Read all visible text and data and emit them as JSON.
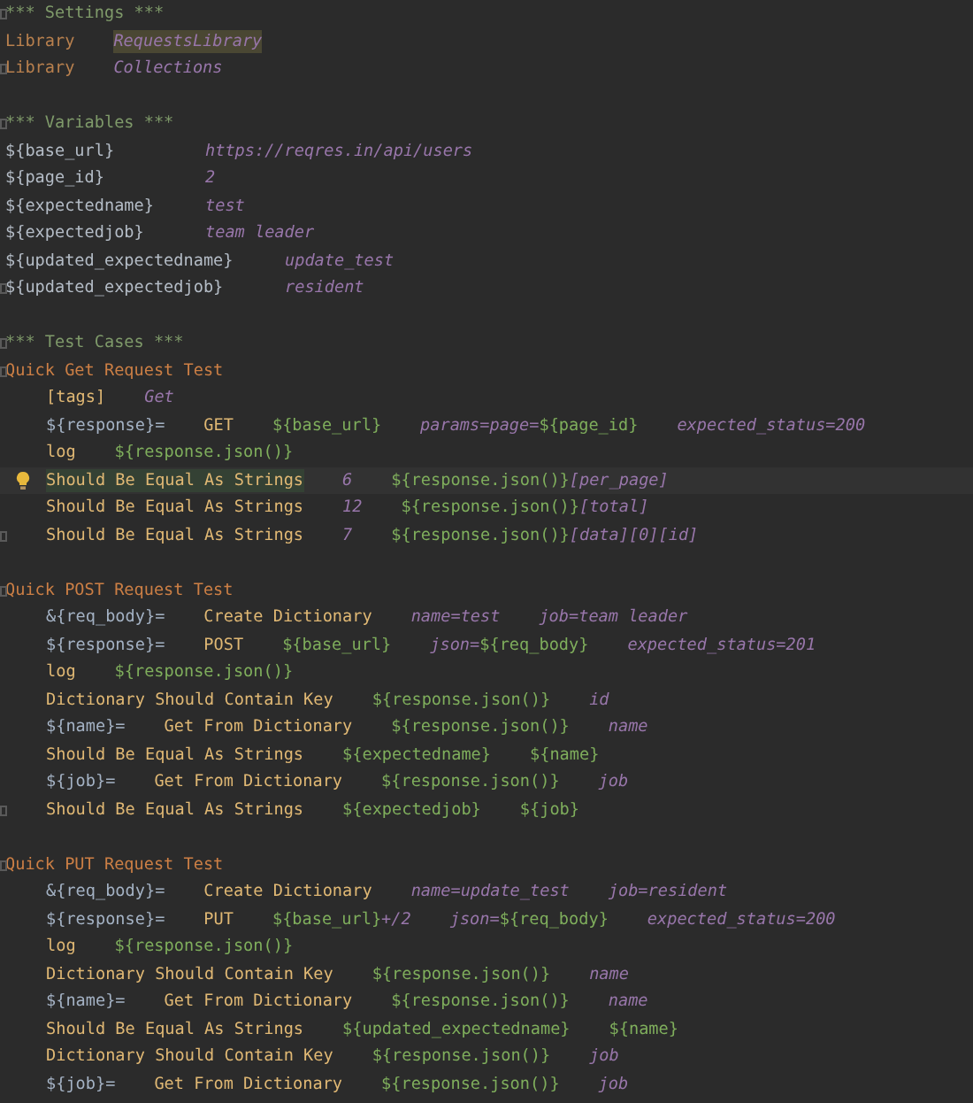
{
  "editor": {
    "lines": [
      {
        "kind": "code",
        "fold_marker": true,
        "tokens": [
          {
            "text": "*** Settings ***",
            "kind": "header"
          }
        ]
      },
      {
        "kind": "code",
        "tokens": [
          {
            "text": "Library",
            "kind": "setting"
          },
          {
            "text": "RequestsLibrary",
            "kind": "value",
            "highlighted": true
          }
        ]
      },
      {
        "kind": "code",
        "fold_marker": true,
        "tokens": [
          {
            "text": "Library",
            "kind": "setting"
          },
          {
            "text": "Collections",
            "kind": "value"
          }
        ]
      },
      {
        "kind": "blank"
      },
      {
        "kind": "code",
        "fold_marker": true,
        "tokens": [
          {
            "text": "*** Variables ***",
            "kind": "header"
          }
        ]
      },
      {
        "kind": "code",
        "tokens": [
          {
            "text": "${base_url}",
            "kind": "variable"
          },
          {
            "text": "https://reqres.in/api/users",
            "kind": "value"
          }
        ]
      },
      {
        "kind": "code",
        "tokens": [
          {
            "text": "${page_id}",
            "kind": "variable"
          },
          {
            "text": "2",
            "kind": "value"
          }
        ]
      },
      {
        "kind": "code",
        "tokens": [
          {
            "text": "${expectedname}",
            "kind": "variable"
          },
          {
            "text": "test",
            "kind": "value"
          }
        ]
      },
      {
        "kind": "code",
        "tokens": [
          {
            "text": "${expectedjob}",
            "kind": "variable"
          },
          {
            "text": "team leader",
            "kind": "value"
          }
        ]
      },
      {
        "kind": "code",
        "tokens": [
          {
            "text": "${updated_expectedname}",
            "kind": "variable"
          },
          {
            "text": "update_test",
            "kind": "value"
          }
        ]
      },
      {
        "kind": "code",
        "fold_marker": true,
        "tokens": [
          {
            "text": "${updated_expectedjob}",
            "kind": "variable"
          },
          {
            "text": "resident",
            "kind": "value"
          }
        ]
      },
      {
        "kind": "blank"
      },
      {
        "kind": "code",
        "fold_marker": true,
        "tokens": [
          {
            "text": "*** Test Cases ***",
            "kind": "header"
          }
        ]
      },
      {
        "kind": "code",
        "fold_marker": true,
        "tokens": [
          {
            "text": "Quick Get Request Test",
            "kind": "testcase"
          }
        ]
      },
      {
        "kind": "step",
        "tokens": [
          {
            "text": "[tags]",
            "kind": "keyword"
          },
          {
            "text": "Get",
            "kind": "value"
          }
        ]
      },
      {
        "kind": "step",
        "tokens": [
          {
            "text": "${response}=",
            "kind": "assign"
          },
          {
            "text": "GET",
            "kind": "keyword"
          },
          {
            "text": "${base_url}",
            "kind": "varref"
          },
          {
            "text": "params=page=",
            "kind": "value"
          },
          {
            "text": "${page_id}",
            "kind": "varref",
            "attached": true
          },
          {
            "text": "expected_status=200",
            "kind": "value"
          }
        ]
      },
      {
        "kind": "step",
        "tokens": [
          {
            "text": "log",
            "kind": "keyword"
          },
          {
            "text": "${response.json()}",
            "kind": "varref"
          }
        ]
      },
      {
        "kind": "step",
        "current": true,
        "bulb": true,
        "tokens": [
          {
            "text": "Should Be Equal As Strings",
            "kind": "keyword",
            "highlighted": true
          },
          {
            "text": "6",
            "kind": "value"
          },
          {
            "text": "${response.json()}",
            "kind": "varref"
          },
          {
            "text": "[per_page]",
            "kind": "value",
            "attached": true
          }
        ]
      },
      {
        "kind": "step",
        "tokens": [
          {
            "text": "Should Be Equal As Strings",
            "kind": "keyword"
          },
          {
            "text": "12",
            "kind": "value"
          },
          {
            "text": "${response.json()}",
            "kind": "varref"
          },
          {
            "text": "[total]",
            "kind": "value",
            "attached": true
          }
        ]
      },
      {
        "kind": "step",
        "fold_marker": true,
        "tokens": [
          {
            "text": "Should Be Equal As Strings",
            "kind": "keyword"
          },
          {
            "text": "7",
            "kind": "value"
          },
          {
            "text": "${response.json()}",
            "kind": "varref"
          },
          {
            "text": "[data][0][id]",
            "kind": "value",
            "attached": true
          }
        ]
      },
      {
        "kind": "blank"
      },
      {
        "kind": "code",
        "fold_marker": true,
        "tokens": [
          {
            "text": "Quick POST Request Test",
            "kind": "testcase"
          }
        ]
      },
      {
        "kind": "step",
        "tokens": [
          {
            "text": "&{req_body}=",
            "kind": "assign"
          },
          {
            "text": "Create Dictionary",
            "kind": "keyword"
          },
          {
            "text": "name=test",
            "kind": "value"
          },
          {
            "text": "job=team leader",
            "kind": "value"
          }
        ]
      },
      {
        "kind": "step",
        "tokens": [
          {
            "text": "${response}=",
            "kind": "assign"
          },
          {
            "text": "POST",
            "kind": "keyword"
          },
          {
            "text": "${base_url}",
            "kind": "varref"
          },
          {
            "text": "json=",
            "kind": "value"
          },
          {
            "text": "${req_body}",
            "kind": "varref",
            "attached": true
          },
          {
            "text": "expected_status=201",
            "kind": "value"
          }
        ]
      },
      {
        "kind": "step",
        "tokens": [
          {
            "text": "log",
            "kind": "keyword"
          },
          {
            "text": "${response.json()}",
            "kind": "varref"
          }
        ]
      },
      {
        "kind": "step",
        "tokens": [
          {
            "text": "Dictionary Should Contain Key",
            "kind": "keyword"
          },
          {
            "text": "${response.json()}",
            "kind": "varref"
          },
          {
            "text": "id",
            "kind": "value"
          }
        ]
      },
      {
        "kind": "step",
        "tokens": [
          {
            "text": "${name}=",
            "kind": "assign"
          },
          {
            "text": "Get From Dictionary",
            "kind": "keyword"
          },
          {
            "text": "${response.json()}",
            "kind": "varref"
          },
          {
            "text": "name",
            "kind": "value"
          }
        ]
      },
      {
        "kind": "step",
        "tokens": [
          {
            "text": "Should Be Equal As Strings",
            "kind": "keyword"
          },
          {
            "text": "${expectedname}",
            "kind": "varref"
          },
          {
            "text": "${name}",
            "kind": "varref"
          }
        ]
      },
      {
        "kind": "step",
        "tokens": [
          {
            "text": "${job}=",
            "kind": "assign"
          },
          {
            "text": "Get From Dictionary",
            "kind": "keyword"
          },
          {
            "text": "${response.json()}",
            "kind": "varref"
          },
          {
            "text": "job",
            "kind": "value"
          }
        ]
      },
      {
        "kind": "step",
        "fold_marker": true,
        "tokens": [
          {
            "text": "Should Be Equal As Strings",
            "kind": "keyword"
          },
          {
            "text": "${expectedjob}",
            "kind": "varref"
          },
          {
            "text": "${job}",
            "kind": "varref"
          }
        ]
      },
      {
        "kind": "blank"
      },
      {
        "kind": "code",
        "fold_marker": true,
        "tokens": [
          {
            "text": "Quick PUT Request Test",
            "kind": "testcase"
          }
        ]
      },
      {
        "kind": "step",
        "tokens": [
          {
            "text": "&{req_body}=",
            "kind": "assign"
          },
          {
            "text": "Create Dictionary",
            "kind": "keyword"
          },
          {
            "text": "name=update_test",
            "kind": "value"
          },
          {
            "text": "job=resident",
            "kind": "value"
          }
        ]
      },
      {
        "kind": "step",
        "tokens": [
          {
            "text": "${response}=",
            "kind": "assign"
          },
          {
            "text": "PUT",
            "kind": "keyword"
          },
          {
            "text": "${base_url}",
            "kind": "varref"
          },
          {
            "text": "+/2",
            "kind": "value",
            "attached": true
          },
          {
            "text": "json=",
            "kind": "value"
          },
          {
            "text": "${req_body}",
            "kind": "varref",
            "attached": true
          },
          {
            "text": "expected_status=200",
            "kind": "value"
          }
        ]
      },
      {
        "kind": "step",
        "tokens": [
          {
            "text": "log",
            "kind": "keyword"
          },
          {
            "text": "${response.json()}",
            "kind": "varref"
          }
        ]
      },
      {
        "kind": "step",
        "tokens": [
          {
            "text": "Dictionary Should Contain Key",
            "kind": "keyword"
          },
          {
            "text": "${response.json()}",
            "kind": "varref"
          },
          {
            "text": "name",
            "kind": "value"
          }
        ]
      },
      {
        "kind": "step",
        "tokens": [
          {
            "text": "${name}=",
            "kind": "assign"
          },
          {
            "text": "Get From Dictionary",
            "kind": "keyword"
          },
          {
            "text": "${response.json()}",
            "kind": "varref"
          },
          {
            "text": "name",
            "kind": "value"
          }
        ]
      },
      {
        "kind": "step",
        "tokens": [
          {
            "text": "Should Be Equal As Strings",
            "kind": "keyword"
          },
          {
            "text": "${updated_expectedname}",
            "kind": "varref"
          },
          {
            "text": "${name}",
            "kind": "varref"
          }
        ]
      },
      {
        "kind": "step",
        "tokens": [
          {
            "text": "Dictionary Should Contain Key",
            "kind": "keyword"
          },
          {
            "text": "${response.json()}",
            "kind": "varref"
          },
          {
            "text": "job",
            "kind": "value"
          }
        ]
      },
      {
        "kind": "step",
        "tokens": [
          {
            "text": "${job}=",
            "kind": "assign"
          },
          {
            "text": "Get From Dictionary",
            "kind": "keyword"
          },
          {
            "text": "${response.json()}",
            "kind": "varref"
          },
          {
            "text": "job",
            "kind": "value"
          }
        ]
      }
    ]
  }
}
